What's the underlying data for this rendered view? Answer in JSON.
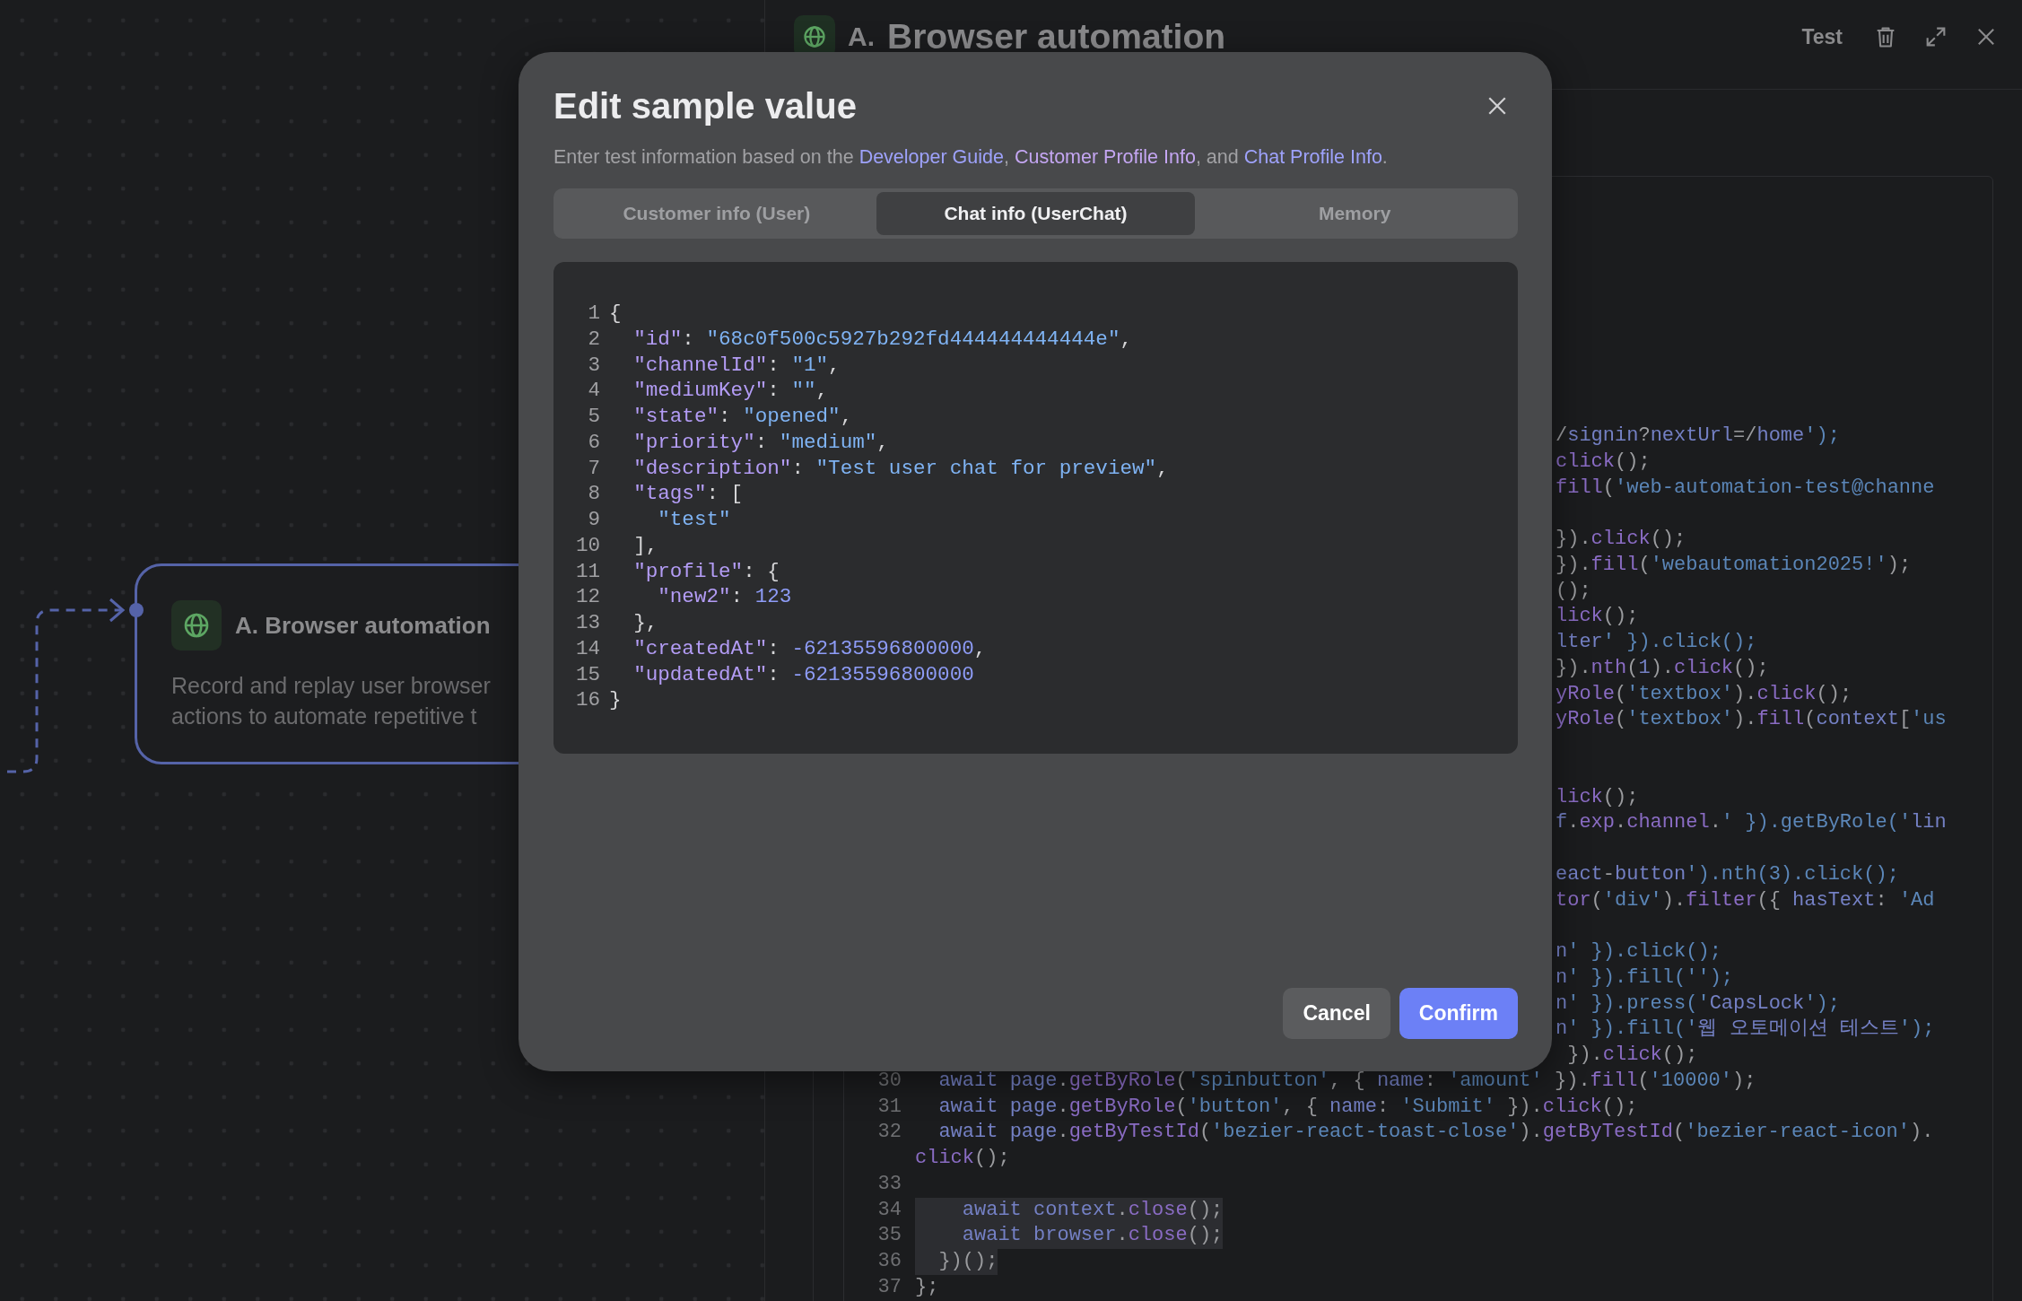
{
  "canvas": {
    "node": {
      "title": "A. Browser automation",
      "description_lines": [
        "Record and replay user browser",
        "actions to automate repetitive t"
      ]
    }
  },
  "panel": {
    "prefix": "A.",
    "title": "Browser automation",
    "actions": [
      {
        "kind": "text",
        "label": "Test"
      },
      {
        "kind": "delete"
      },
      {
        "kind": "expand"
      },
      {
        "kind": "close"
      }
    ],
    "code_rows": [
      {
        "kind": "tail",
        "text": "/signin?nextUrl=/home');"
      },
      {
        "kind": "tail",
        "text": "click();"
      },
      {
        "kind": "tail",
        "text": "fill('web-automation-test@channe"
      },
      {
        "kind": "blank"
      },
      {
        "kind": "tail",
        "text": "}).click();"
      },
      {
        "kind": "tail",
        "text": "}).fill('webautomation2025!');"
      },
      {
        "kind": "tail",
        "text": "();"
      },
      {
        "kind": "tail",
        "text": "lick();"
      },
      {
        "kind": "tail",
        "text": "lter' }).click();"
      },
      {
        "kind": "tail",
        "text": "}).nth(1).click();"
      },
      {
        "kind": "tail",
        "text": "yRole('textbox').click();"
      },
      {
        "kind": "tail",
        "text": "yRole('textbox').fill(context['us"
      },
      {
        "kind": "blank"
      },
      {
        "kind": "blank"
      },
      {
        "kind": "tail",
        "text": "lick();"
      },
      {
        "kind": "tail",
        "text": "f.exp.channel.' }).getByRole('lin"
      },
      {
        "kind": "blank"
      },
      {
        "kind": "tail",
        "text": "eact-button').nth(3).click();"
      },
      {
        "kind": "tail",
        "text": "tor('div').filter({ hasText: 'Ad"
      },
      {
        "kind": "blank"
      },
      {
        "kind": "tail",
        "text": "n' }).click();"
      },
      {
        "kind": "tail",
        "text": "n' }).fill('');"
      },
      {
        "kind": "tail",
        "text": "n' }).press('CapsLock');"
      },
      {
        "kind": "tail",
        "text": "n' }).fill('웹 오토메이션 테스트');"
      },
      {
        "kind": "tail",
        "text": " }).click();"
      },
      {
        "kind": "line",
        "number": "30",
        "text": "  await page.getByRole('spinbutton', { name: 'amount' }).fill('10000');",
        "selected": false
      },
      {
        "kind": "line",
        "number": "31",
        "text": "  await page.getByRole('button', { name: 'Submit' }).click();",
        "selected": false
      },
      {
        "kind": "line",
        "number": "32",
        "text": "  await page.getByTestId('bezier-react-toast-close').getByTestId('bezier-react-icon').",
        "selected": false
      },
      {
        "kind": "wrap",
        "text": "click();"
      },
      {
        "kind": "line",
        "number": "33"
      },
      {
        "kind": "line",
        "number": "34",
        "text": "    await context.close();",
        "selected": true
      },
      {
        "kind": "line",
        "number": "35",
        "text": "    await browser.close();",
        "selected": true
      },
      {
        "kind": "line",
        "number": "36",
        "text": "  })();",
        "selected": true
      },
      {
        "kind": "line",
        "number": "37",
        "text": "};",
        "selected": false
      }
    ]
  },
  "dialog": {
    "title": "Edit sample value",
    "description": {
      "text_parts": [
        "Enter test information based on the ",
        ", ",
        ", and ",
        "."
      ],
      "links": [
        {
          "text": "Developer Guide",
          "visited": false
        },
        {
          "text": "Customer Profile Info",
          "visited": true
        },
        {
          "text": "Chat Profile Info",
          "visited": false
        }
      ]
    },
    "tabs": [
      {
        "label": "Customer info (User)",
        "selected": false
      },
      {
        "label": "Chat info (UserChat)",
        "selected": true
      },
      {
        "label": "Memory",
        "selected": false
      }
    ],
    "code_lines": [
      {
        "number": "1",
        "text": "{"
      },
      {
        "number": "2",
        "text": "  \"id\": \"68c0f500c5927b292fd444444444444e\","
      },
      {
        "number": "3",
        "text": "  \"channelId\": \"1\","
      },
      {
        "number": "4",
        "text": "  \"mediumKey\": \"\","
      },
      {
        "number": "5",
        "text": "  \"state\": \"opened\","
      },
      {
        "number": "6",
        "text": "  \"priority\": \"medium\","
      },
      {
        "number": "7",
        "text": "  \"description\": \"Test user chat for preview\","
      },
      {
        "number": "8",
        "text": "  \"tags\": ["
      },
      {
        "number": "9",
        "text": "    \"test\""
      },
      {
        "number": "10",
        "text": "  ],"
      },
      {
        "number": "11",
        "text": "  \"profile\": {"
      },
      {
        "number": "12",
        "text": "    \"new2\": 123"
      },
      {
        "number": "13",
        "text": "  },"
      },
      {
        "number": "14",
        "text": "  \"createdAt\": -62135596800000,"
      },
      {
        "number": "15",
        "text": "  \"updatedAt\": -62135596800000"
      },
      {
        "number": "16",
        "text": "}"
      }
    ],
    "buttons": [
      {
        "kind": "secondary",
        "label": "Cancel"
      },
      {
        "kind": "primary",
        "label": "Confirm"
      }
    ]
  }
}
